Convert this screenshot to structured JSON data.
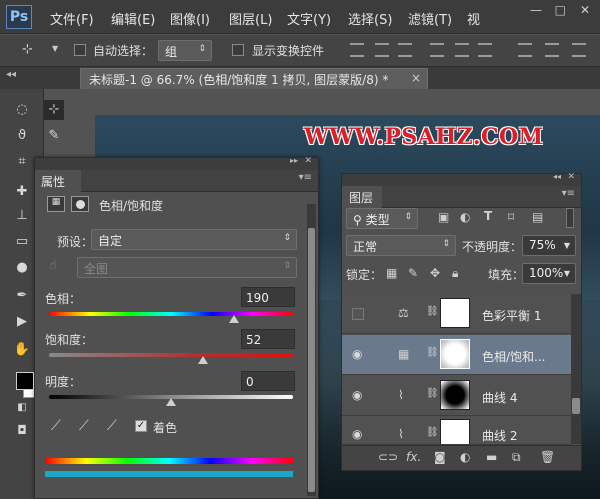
{
  "app": {
    "logo": "Ps"
  },
  "menu": {
    "items": [
      "文件(F)",
      "编辑(E)",
      "图像(I)",
      "图层(L)",
      "文字(Y)",
      "选择(S)",
      "滤镜(T)",
      "视"
    ],
    "window_controls": [
      "—",
      "□",
      "✕"
    ]
  },
  "options_bar": {
    "auto_select_label": "自动选择：",
    "auto_select_value": "组",
    "show_transform_label": "显示变换控件"
  },
  "document_tab": {
    "title": "未标题-1 @ 66.7% (色相/饱和度 1 拷贝, 图层蒙版/8) *",
    "close": "×"
  },
  "canvas": {
    "watermark": "WWW.PSAHZ.COM"
  },
  "properties_panel": {
    "tab": "属性",
    "adjustment_title": "色相/饱和度",
    "preset_label": "预设：",
    "preset_value": "自定",
    "channel_value": "全图",
    "hue_label": "色相：",
    "hue_value": "190",
    "hue_fraction": 0.76,
    "saturation_label": "饱和度：",
    "saturation_value": "52",
    "saturation_fraction": 0.63,
    "lightness_label": "明度：",
    "lightness_value": "0",
    "lightness_fraction": 0.5,
    "colorize_label": "着色",
    "colorize_checked": true
  },
  "layers_panel": {
    "tab": "图层",
    "filter_kind": "类型",
    "blend_mode": "正常",
    "opacity_label": "不透明度：",
    "opacity_value": "75%",
    "lock_label": "锁定：",
    "fill_label": "填充：",
    "fill_value": "100%",
    "layers": [
      {
        "name": "色彩平衡 1",
        "visible": false,
        "selected": false,
        "mask": "white"
      },
      {
        "name": "色相/饱和...",
        "visible": true,
        "selected": true,
        "mask": "white-glow"
      },
      {
        "name": "曲线 4",
        "visible": true,
        "selected": false,
        "mask": "black-glow"
      },
      {
        "name": "曲线 2",
        "visible": true,
        "selected": false,
        "mask": "white"
      }
    ],
    "footer_icons": [
      "link-icon",
      "fx-icon",
      "mask-icon",
      "adjustment-icon",
      "folder-icon",
      "new-layer-icon",
      "trash-icon"
    ]
  },
  "colors": {
    "watermark": "#d91f2a",
    "selected_layer": "#6a7a8c",
    "panel_bg": "#505050"
  }
}
